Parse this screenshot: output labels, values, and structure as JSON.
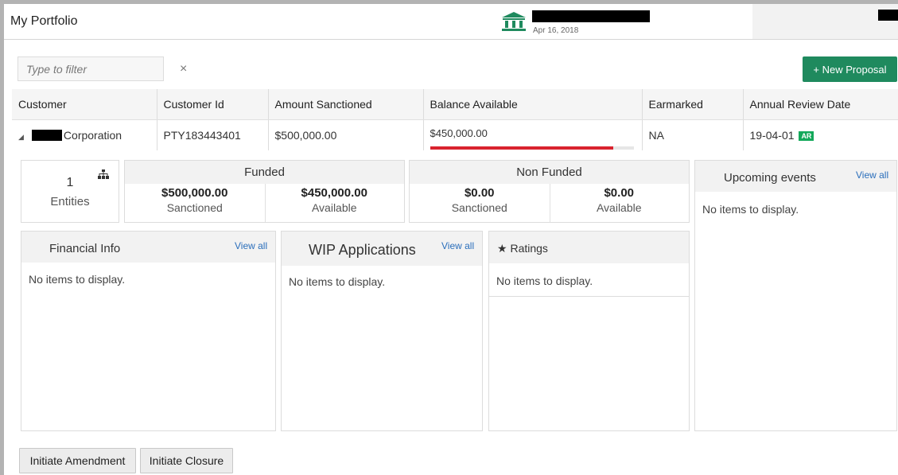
{
  "header": {
    "title": "My Portfolio",
    "date": "Apr 16, 2018",
    "logo_icon": "bank-icon"
  },
  "filter": {
    "placeholder": "Type to filter",
    "value": "",
    "clear_label": "×"
  },
  "toolbar": {
    "new_proposal_label": "+ New Proposal"
  },
  "table": {
    "columns": [
      "Customer",
      "Customer Id",
      "Amount Sanctioned",
      "Balance Available",
      "Earmarked",
      "Annual Review Date"
    ],
    "rows": [
      {
        "expand_icon": "◢",
        "customer": "Corporation",
        "customer_id": "PTY183443401",
        "amount_sanctioned": "$500,000.00",
        "balance_available": "$450,000.00",
        "balance_fraction": 0.9,
        "earmarked": "NA",
        "annual_review_date": "19-04-01",
        "review_badge": "AR"
      }
    ]
  },
  "summary": {
    "entities_count": "1",
    "entities_label": "Entities",
    "funded": {
      "title": "Funded",
      "sanctioned_amount": "$500,000.00",
      "sanctioned_label": "Sanctioned",
      "available_amount": "$450,000.00",
      "available_label": "Available"
    },
    "non_funded": {
      "title": "Non Funded",
      "sanctioned_amount": "$0.00",
      "sanctioned_label": "Sanctioned",
      "available_amount": "$0.00",
      "available_label": "Available"
    }
  },
  "panels": {
    "upcoming_events": {
      "title": "Upcoming events",
      "view_all": "View all",
      "empty": "No items to display."
    },
    "financial_info": {
      "title": "Financial Info",
      "view_all": "View all",
      "empty": "No items to display."
    },
    "wip_applications": {
      "title": "WIP Applications",
      "view_all": "View all",
      "empty": "No items to display."
    },
    "ratings": {
      "title": "Ratings",
      "star": "★",
      "empty": "No items to display."
    }
  },
  "actions": {
    "initiate_amendment": "Initiate Amendment",
    "initiate_closure": "Initiate Closure"
  },
  "colors": {
    "accent_green": "#1f8a5e",
    "balance_bar": "#d9232e",
    "badge_green": "#13a85a",
    "link_blue": "#2a6ebb"
  }
}
